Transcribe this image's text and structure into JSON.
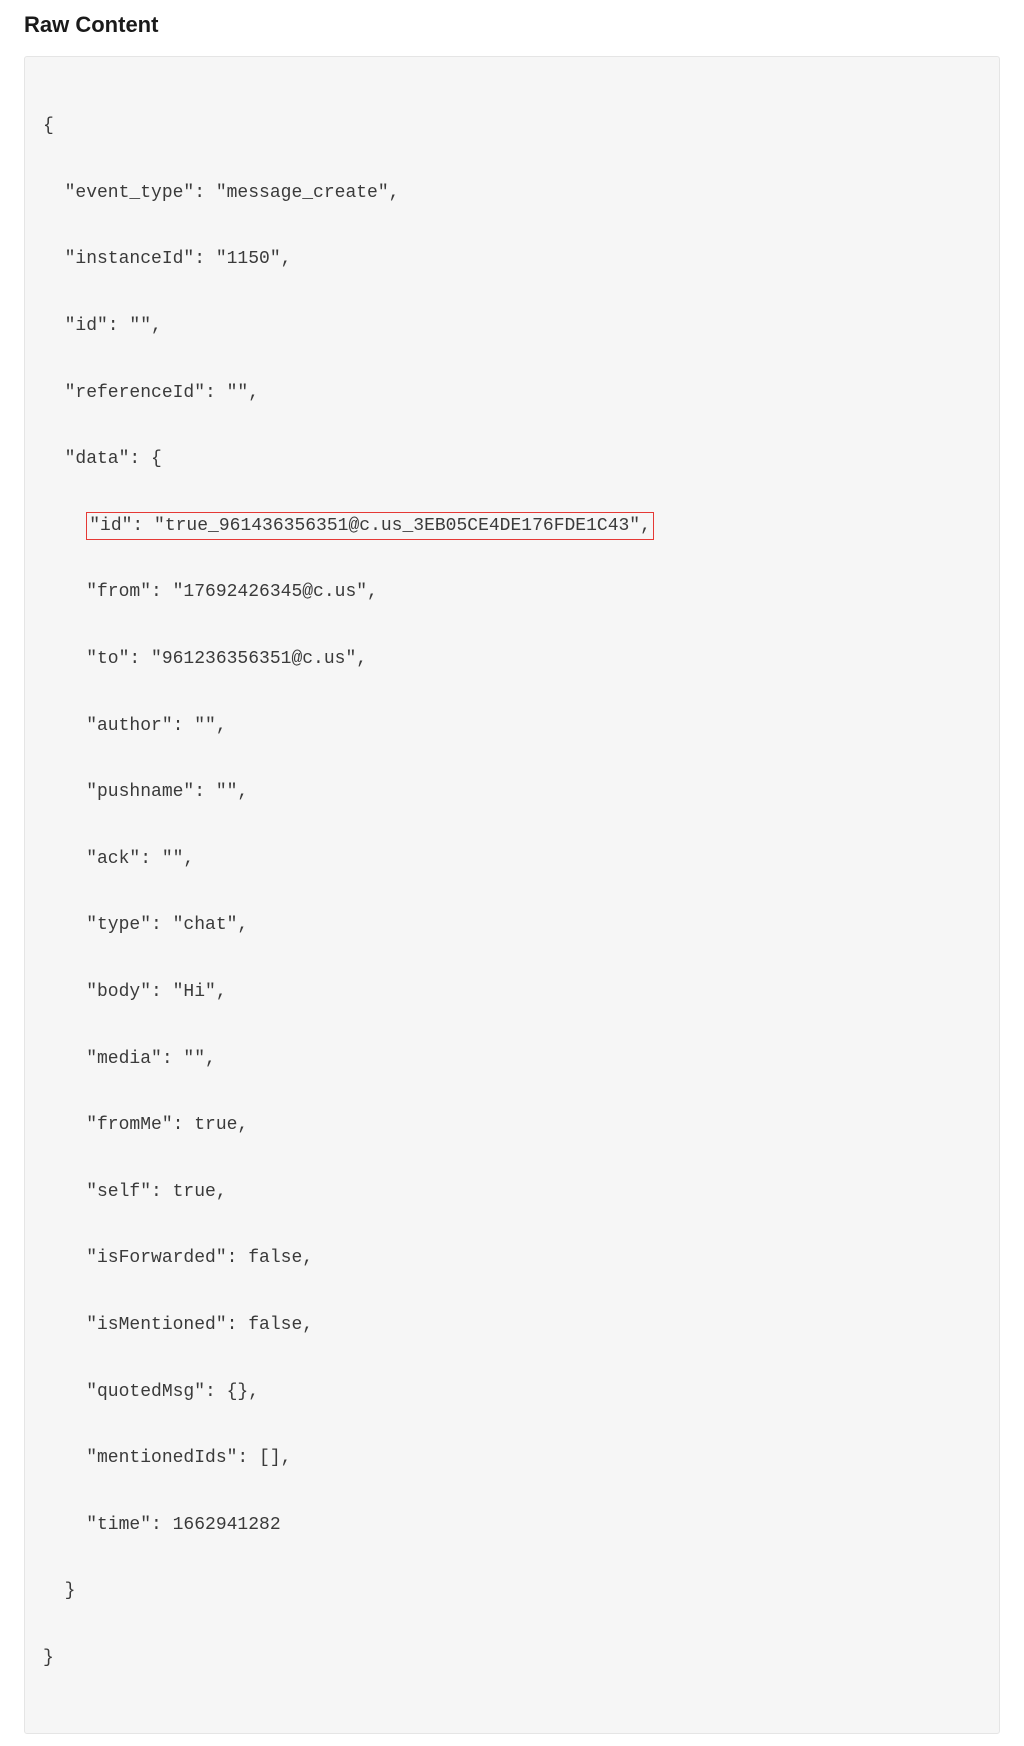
{
  "title": "Raw Content",
  "code": {
    "open_brace": "{",
    "event_type_line": "  \"event_type\": \"message_create\",",
    "instanceId_line": "  \"instanceId\": \"1150\",",
    "id_line": "  \"id\": \"\",",
    "referenceId_line": "  \"referenceId\": \"\",",
    "data_open_line": "  \"data\": {",
    "data_id_prefix": "    ",
    "data_id_highlight": "\"id\": \"true_961436356351@c.us_3EB05CE4DE176FDE1C43\",",
    "from_line": "    \"from\": \"17692426345@c.us\",",
    "to_line": "    \"to\": \"961236356351@c.us\",",
    "author_line": "    \"author\": \"\",",
    "pushname_line": "    \"pushname\": \"\",",
    "ack_line": "    \"ack\": \"\",",
    "type_line": "    \"type\": \"chat\",",
    "body_line": "    \"body\": \"Hi\",",
    "media_line": "    \"media\": \"\",",
    "fromMe_line": "    \"fromMe\": true,",
    "self_line": "    \"self\": true,",
    "isForwarded_line": "    \"isForwarded\": false,",
    "isMentioned_line": "    \"isMentioned\": false,",
    "quotedMsg_line": "    \"quotedMsg\": {},",
    "mentionedIds_line": "    \"mentionedIds\": [],",
    "time_line": "    \"time\": 1662941282",
    "data_close_line": "  }",
    "close_brace": "}"
  }
}
